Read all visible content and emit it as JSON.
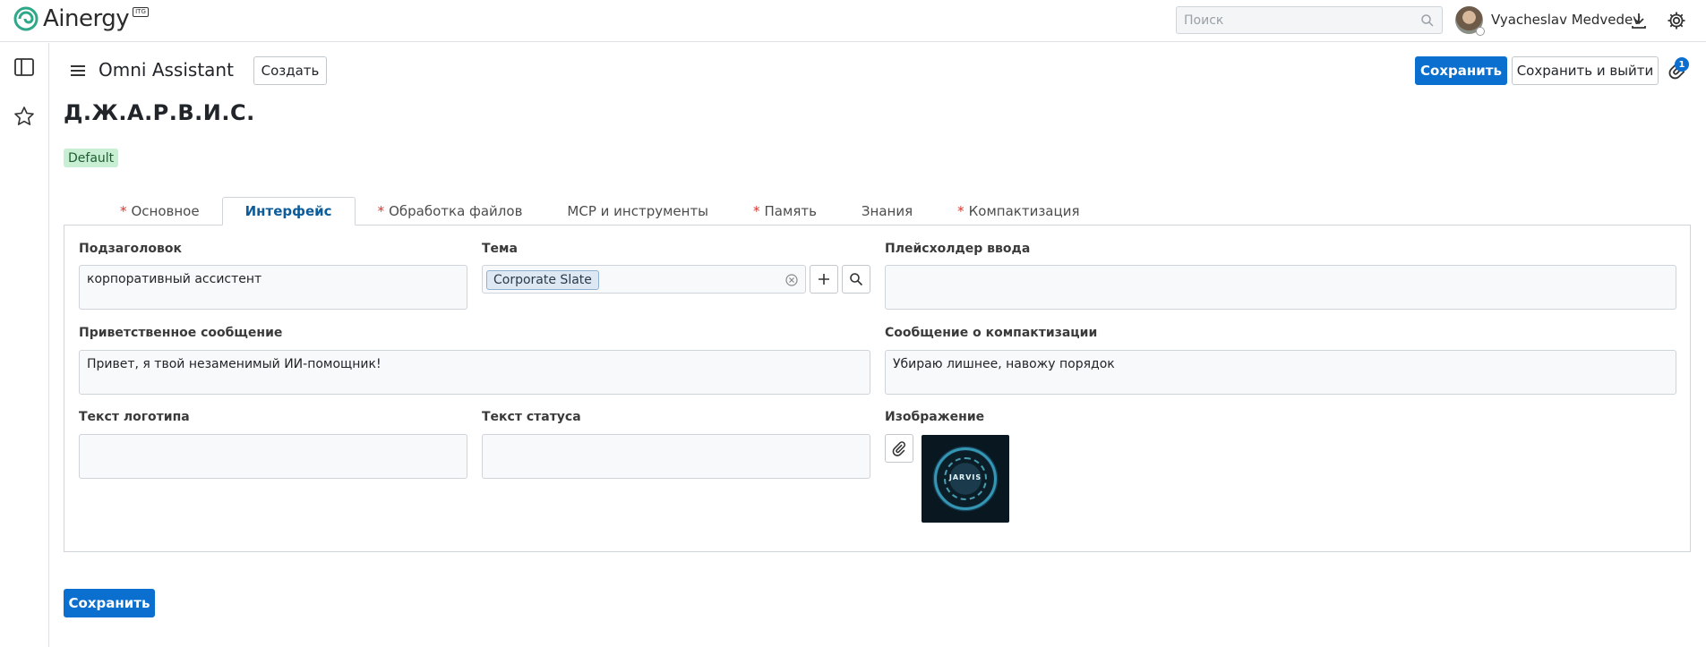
{
  "app": {
    "logo_text": "Ainergy",
    "logo_badge": "ITG",
    "search_placeholder": "Поиск",
    "user_name": "Vyacheslav Medvedev"
  },
  "control_panel": {
    "breadcrumb": "Omni Assistant",
    "create_label": "Создать",
    "save_label": "Сохранить",
    "save_exit_label": "Сохранить и выйти",
    "attachment_count": "1"
  },
  "record": {
    "title": "Д.Ж.А.Р.В.И.С.",
    "badge": "Default"
  },
  "tabs": [
    {
      "label": "Основное",
      "required": true,
      "active": false
    },
    {
      "label": "Интерфейс",
      "required": false,
      "active": true
    },
    {
      "label": "Обработка файлов",
      "required": true,
      "active": false
    },
    {
      "label": "MCP и инструменты",
      "required": false,
      "active": false
    },
    {
      "label": "Память",
      "required": true,
      "active": false
    },
    {
      "label": "Знания",
      "required": false,
      "active": false
    },
    {
      "label": "Компактизация",
      "required": true,
      "active": false
    }
  ],
  "form": {
    "subtitle_label": "Подзаголовок",
    "subtitle_value": "корпоративный ассистент",
    "theme_label": "Тема",
    "theme_value": "Corporate Slate",
    "input_placeholder_label": "Плейсхолдер ввода",
    "input_placeholder_value": "",
    "welcome_label": "Приветственное сообщение",
    "welcome_value": "Привет, я твой незаменимый ИИ-помощник!",
    "compaction_msg_label": "Сообщение о компактизации",
    "compaction_msg_value": "Убираю лишнее, навожу порядок",
    "logo_text_label": "Текст логотипа",
    "logo_text_value": "",
    "status_text_label": "Текст статуса",
    "status_text_value": "",
    "image_label": "Изображение",
    "image_caption": "JARVIS"
  },
  "footer": {
    "save_label": "Сохранить"
  },
  "colors": {
    "primary": "#0a6fcf",
    "required": "#d9342b",
    "badge_bg": "#c8efd3",
    "active_tab": "#0e5c99"
  },
  "icons": [
    "logo-mark-icon",
    "search-icon",
    "download-icon",
    "gear-icon",
    "sidebar-toggle-icon",
    "star-icon",
    "hamburger-icon",
    "paperclip-icon",
    "clear-circle-icon",
    "plus-icon",
    "magnifier-icon"
  ]
}
